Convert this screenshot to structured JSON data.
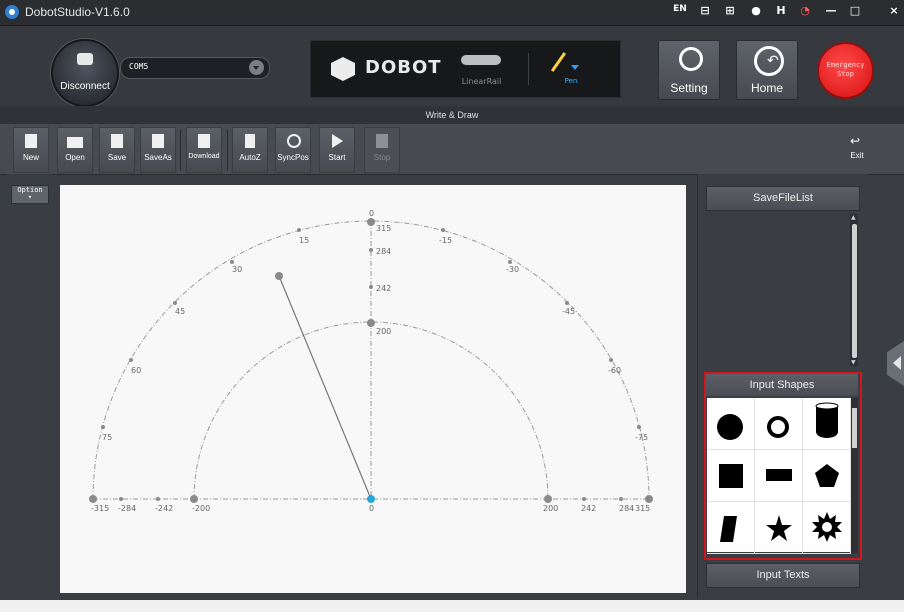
{
  "window": {
    "title": "DobotStudio-V1.6.0",
    "title_icons": [
      "EN",
      "⊟",
      "⊞",
      "●",
      "H",
      "◔",
      "—",
      "□",
      "×"
    ]
  },
  "header": {
    "disconnect_label": "Disconnect",
    "port_value": "COM5",
    "device_brand": "DOBOT",
    "linear_rail_label": "LinearRail",
    "pen_label": "Pen",
    "setting_label": "Setting",
    "home_label": "Home",
    "estop_line1": "Emergency",
    "estop_line2": "Stop"
  },
  "caption": "Write & Draw",
  "toolbar": {
    "new": "New",
    "open": "Open",
    "save": "Save",
    "save_as": "SaveAs",
    "download": "Download",
    "autoz": "AutoZ",
    "syncpos": "SyncPos",
    "start": "Start",
    "stop": "Stop",
    "exit": "Exit"
  },
  "option": {
    "line1": "Option",
    "line2": "▾"
  },
  "canvas": {
    "x_ticks_left": [
      "-315",
      "-284",
      "-242",
      "-200"
    ],
    "x_tick_center": "0",
    "x_ticks_right": [
      "200",
      "242",
      "284",
      "315"
    ],
    "y_ticks": [
      "0",
      "315",
      "284",
      "242",
      "200"
    ],
    "angle_labels_left": [
      "15",
      "30",
      "45",
      "60",
      "75"
    ],
    "angle_labels_right": [
      "-15",
      "-30",
      "-45",
      "-60",
      "-75"
    ],
    "accent_color": "#2aa3dc",
    "arm_color": "#777777"
  },
  "right_panel": {
    "save_file_list": "SaveFileList",
    "input_shapes": "Input Shapes",
    "input_texts": "Input Texts",
    "shapes": [
      "circle-icon",
      "ring-icon",
      "cylinder-icon",
      "square-icon",
      "bar-icon",
      "pentagon-icon",
      "parallelogram-icon",
      "star-icon",
      "sun-icon"
    ]
  },
  "highlight_color": "#d0161f"
}
